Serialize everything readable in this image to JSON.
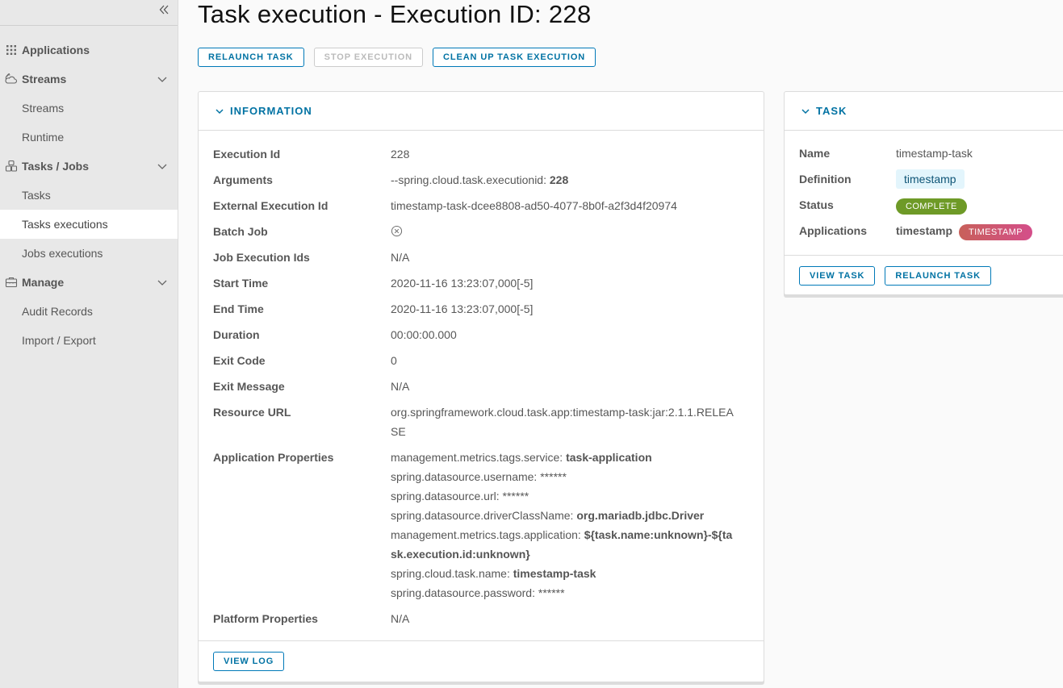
{
  "sidebar": {
    "collapse_glyph": "«",
    "groups": [
      {
        "label": "Applications",
        "icon": "grid-icon",
        "items": []
      },
      {
        "label": "Streams",
        "icon": "streams-icon",
        "items": [
          {
            "label": "Streams"
          },
          {
            "label": "Runtime"
          }
        ]
      },
      {
        "label": "Tasks / Jobs",
        "icon": "tasks-icon",
        "items": [
          {
            "label": "Tasks"
          },
          {
            "label": "Tasks executions",
            "active": true
          },
          {
            "label": "Jobs executions"
          }
        ]
      },
      {
        "label": "Manage",
        "icon": "briefcase-icon",
        "items": [
          {
            "label": "Audit Records"
          },
          {
            "label": "Import / Export"
          }
        ]
      }
    ]
  },
  "header": {
    "title_prefix": "Task execution - Execution ID: ",
    "title_id": "228"
  },
  "actions": {
    "relaunch": "Relaunch task",
    "stop": "Stop execution",
    "cleanup": "Clean up task execution"
  },
  "information": {
    "title": "INFORMATION",
    "rows": {
      "execution_id": {
        "label": "Execution Id",
        "value": "228"
      },
      "arguments": {
        "label": "Arguments",
        "key": "--spring.cloud.task.executionid: ",
        "value": "228"
      },
      "external_execution_id": {
        "label": "External Execution Id",
        "value": "timestamp-task-dcee8808-ad50-4077-8b0f-a2f3d4f20974"
      },
      "batch_job": {
        "label": "Batch Job",
        "icon": "x-circle-icon"
      },
      "job_execution_ids": {
        "label": "Job Execution Ids",
        "value": "N/A"
      },
      "start_time": {
        "label": "Start Time",
        "value": "2020-11-16 13:23:07,000[-5]"
      },
      "end_time": {
        "label": "End Time",
        "value": "2020-11-16 13:23:07,000[-5]"
      },
      "duration": {
        "label": "Duration",
        "value": "00:00:00.000"
      },
      "exit_code": {
        "label": "Exit Code",
        "value": "0"
      },
      "exit_message": {
        "label": "Exit Message",
        "value": "N/A"
      },
      "resource_url": {
        "label": "Resource URL",
        "value": "org.springframework.cloud.task.app:timestamp-task:jar:2.1.1.RELEASE"
      },
      "application_properties": {
        "label": "Application Properties",
        "props": [
          {
            "key": "management.metrics.tags.service: ",
            "value": "task-application",
            "bold": true
          },
          {
            "key": "spring.datasource.username: ",
            "value": "******",
            "bold": false
          },
          {
            "key": "spring.datasource.url: ",
            "value": "******",
            "bold": false
          },
          {
            "key": "spring.datasource.driverClassName: ",
            "value": "org.mariadb.jdbc.Driver",
            "bold": true
          },
          {
            "key": "management.metrics.tags.application: ",
            "value": "${task.name:unknown}-${task.execution.id:unknown}",
            "bold": true
          },
          {
            "key": "spring.cloud.task.name: ",
            "value": "timestamp-task",
            "bold": true
          },
          {
            "key": "spring.datasource.password: ",
            "value": "******",
            "bold": false
          }
        ]
      },
      "platform_properties": {
        "label": "Platform Properties",
        "value": "N/A"
      }
    },
    "view_log": "View log"
  },
  "task": {
    "title": "TASK",
    "name_label": "Name",
    "name_value": "timestamp-task",
    "definition_label": "Definition",
    "definition_value": "timestamp",
    "status_label": "Status",
    "status_value": "COMPLETE",
    "applications_label": "Applications",
    "applications_name": "timestamp",
    "applications_badge": "TIMESTAMP",
    "view_task": "View task",
    "relaunch_task": "Relaunch task"
  },
  "colors": {
    "accent": "#0072a3",
    "complete": "#6e9a27",
    "app_badge": "#d44e8a"
  }
}
